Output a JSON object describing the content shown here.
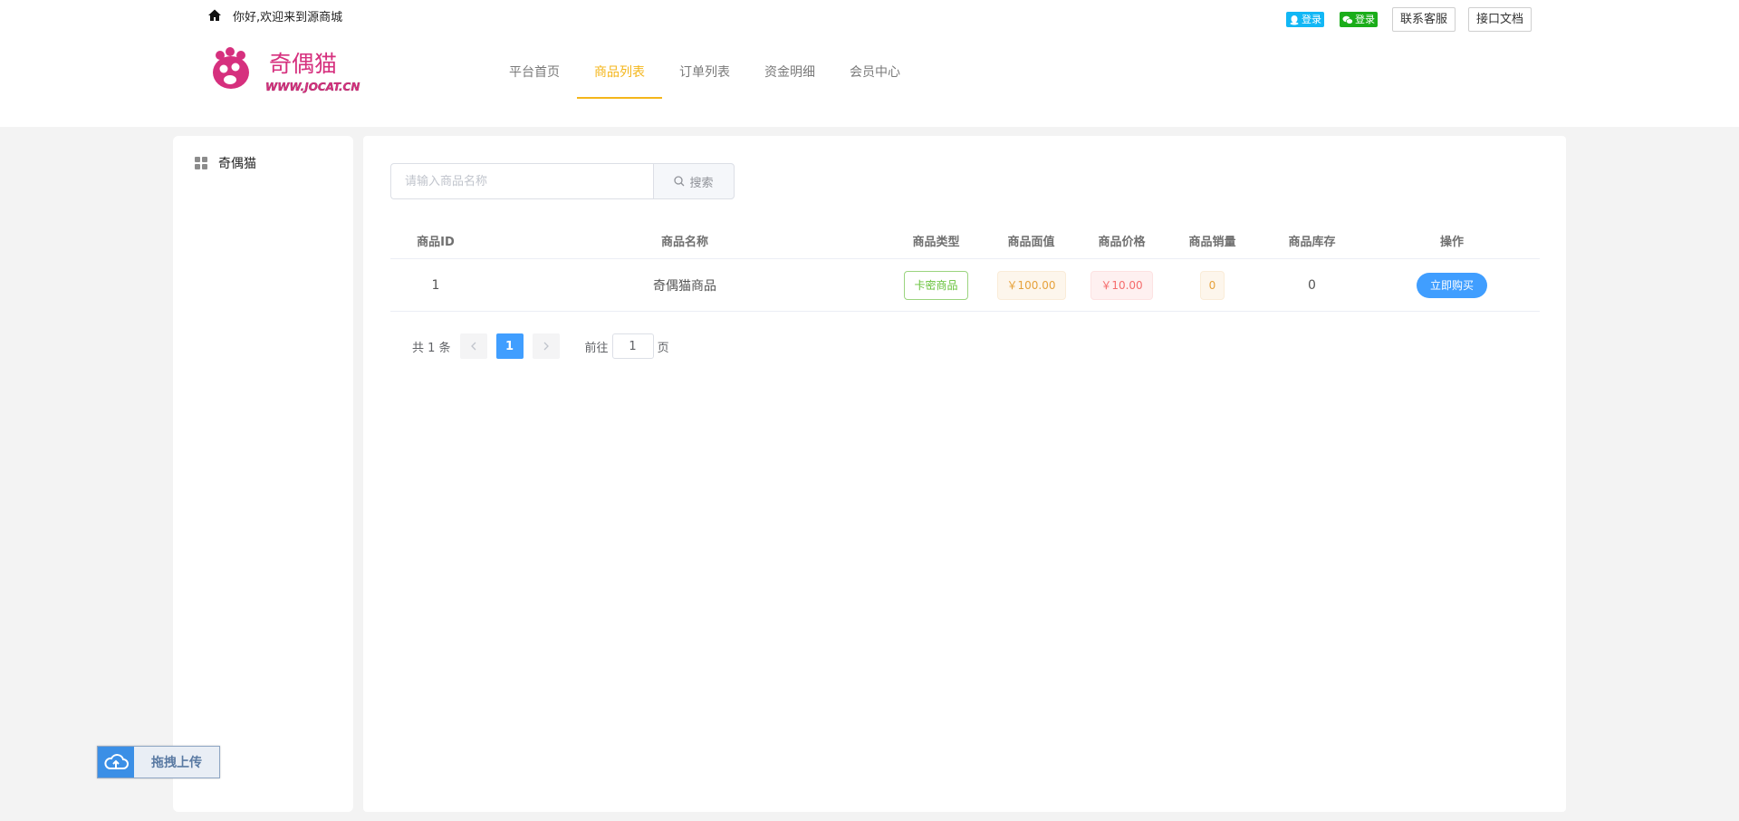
{
  "header": {
    "welcome": "你好,欢迎来到源商城",
    "qq_login": "登录",
    "wechat_login": "登录",
    "contact_service": "联系客服",
    "api_docs": "接口文档",
    "logo_text": "奇偶猫",
    "logo_url_text": "WWW.JOCAT.CN",
    "colors": {
      "accent": "#f4b61b",
      "qq": "#12b7f5",
      "wechat": "#1aad19",
      "logo": "#d6307e"
    }
  },
  "nav": {
    "items": [
      {
        "label": "平台首页"
      },
      {
        "label": "商品列表"
      },
      {
        "label": "订单列表"
      },
      {
        "label": "资金明细"
      },
      {
        "label": "会员中心"
      }
    ],
    "active_index": 1
  },
  "sidebar": {
    "items": [
      {
        "label": "奇偶猫",
        "icon": "grid-icon"
      }
    ]
  },
  "search": {
    "placeholder": "请输入商品名称",
    "value": "",
    "button_label": "搜索"
  },
  "table": {
    "headers": {
      "id": "商品ID",
      "name": "商品名称",
      "type": "商品类型",
      "face": "商品面值",
      "price": "商品价格",
      "sales": "商品销量",
      "stock": "商品库存",
      "op": "操作"
    },
    "rows": [
      {
        "id": "1",
        "name": "奇偶猫商品",
        "type": "卡密商品",
        "face": "￥100.00",
        "price": "￥10.00",
        "sales": "0",
        "stock": "0",
        "action": "立即购买"
      }
    ]
  },
  "pagination": {
    "total_text": "共 1 条",
    "current_page": "1",
    "goto_prefix": "前往",
    "goto_value": "1",
    "goto_suffix": "页"
  },
  "upload_widget": {
    "label": "拖拽上传"
  },
  "colors": {
    "primary": "#409eff",
    "success": "#67c23a",
    "warning": "#e6a23c",
    "danger": "#f56c6c"
  }
}
